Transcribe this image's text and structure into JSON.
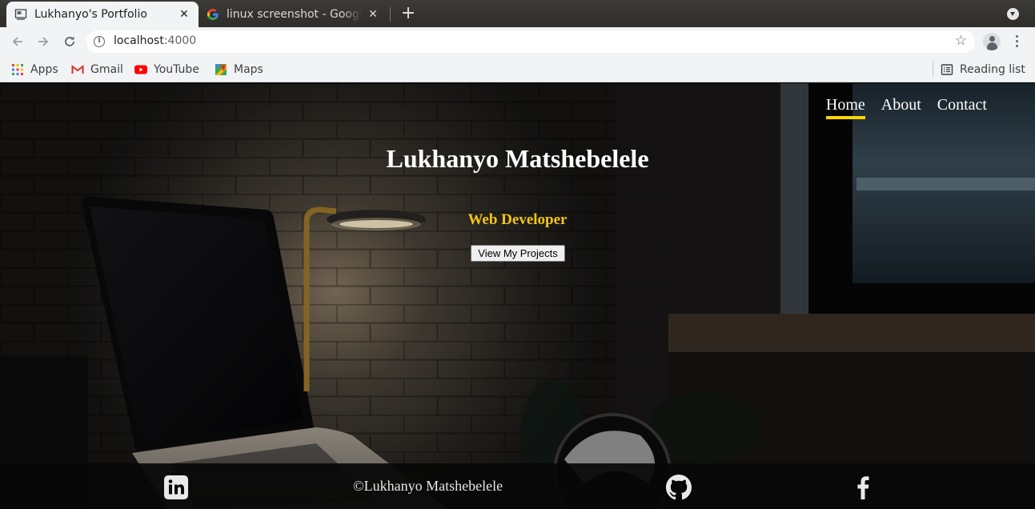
{
  "browser": {
    "tabs": [
      {
        "title": "Lukhanyo's Portfolio",
        "active": true
      },
      {
        "title": "linux screenshot - Google",
        "active": false
      }
    ],
    "new_tab_label": "+",
    "address": {
      "host": "localhost",
      "port": ":4000"
    },
    "bookmarks": [
      {
        "label": "Apps",
        "icon": "apps-grid-icon"
      },
      {
        "label": "Gmail",
        "icon": "gmail-icon"
      },
      {
        "label": "YouTube",
        "icon": "youtube-icon"
      },
      {
        "label": "Maps",
        "icon": "maps-icon"
      }
    ],
    "reading_list": "Reading list"
  },
  "site": {
    "nav": [
      {
        "label": "Home",
        "active": true
      },
      {
        "label": "About",
        "active": false
      },
      {
        "label": "Contact",
        "active": false
      }
    ],
    "hero": {
      "name": "Lukhanyo Matshebelele",
      "role": "Web Developer",
      "cta": "View My Projects"
    },
    "footer": {
      "copyright": "©Lukhanyo Matshebelele",
      "social": [
        "linkedin-icon",
        "github-icon",
        "facebook-icon"
      ]
    },
    "colors": {
      "accent": "#ffd500",
      "role_text": "#f5c518",
      "footer_bg": "#080808"
    }
  }
}
